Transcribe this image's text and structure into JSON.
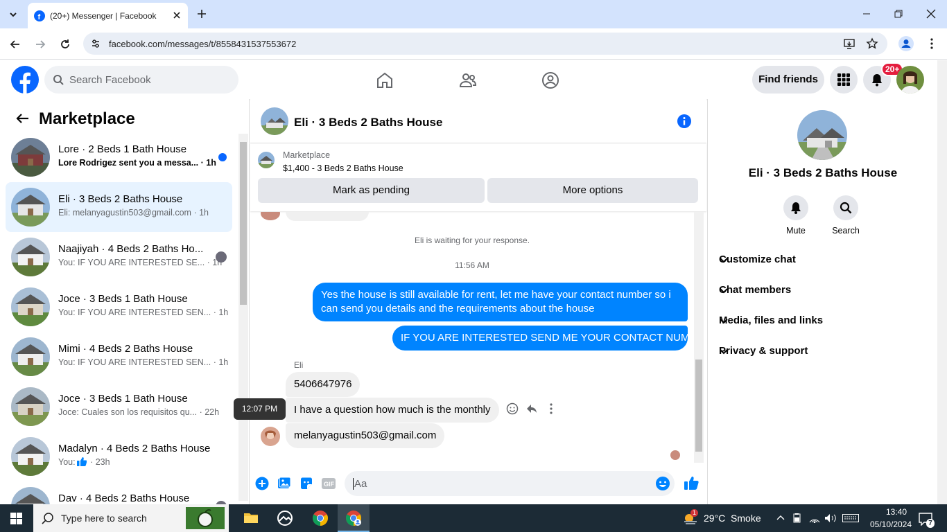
{
  "browser": {
    "tab_title": "(20+) Messenger | Facebook",
    "url": "facebook.com/messages/t/8558431537553672"
  },
  "fb": {
    "search_placeholder": "Search Facebook",
    "find_friends": "Find friends",
    "notif_badge": "20+"
  },
  "left": {
    "title": "Marketplace",
    "conversations": [
      {
        "name": "Lore · 2 Beds 1 Bath House",
        "preview": "Lore Rodrigez sent you a messa...",
        "time": "· 1h",
        "unread": true
      },
      {
        "name": "Eli · 3 Beds 2 Baths House",
        "preview": "Eli: melanyagustin503@gmail.com",
        "time": "· 1h",
        "selected": true
      },
      {
        "name": "Naajiyah · 4 Beds 2 Baths Ho...",
        "preview": "You: IF YOU ARE INTERESTED SE...",
        "time": "· 1h"
      },
      {
        "name": "Joce · 3 Beds 1 Bath House",
        "preview": "You: IF YOU ARE INTERESTED SEN...",
        "time": "· 1h"
      },
      {
        "name": "Mimi · 4 Beds 2 Baths House",
        "preview": "You: IF YOU ARE INTERESTED SEN...",
        "time": "· 1h"
      },
      {
        "name": "Joce · 3 Beds 1 Bath House",
        "preview": "Joce: Cuales son los requisitos qu...",
        "time": "· 22h"
      },
      {
        "name": "Madalyn · 4 Beds 2 Baths House",
        "preview": "You:",
        "time": "· 23h"
      },
      {
        "name": "Dav · 4 Beds 2 Baths House",
        "preview": "",
        "time": ""
      }
    ]
  },
  "chat": {
    "title": "Eli · 3 Beds 2 Baths House",
    "listing_label": "Marketplace",
    "listing_price": "$1,400 - 3 Beds 2 Baths House",
    "mark_pending": "Mark as pending",
    "more_options": "More options",
    "waiting_notice": "Eli is waiting for your response.",
    "time_divider": "11:56 AM",
    "messages": [
      {
        "from": "me",
        "text": "Yes the house is still available for rent, let me have your contact number so i can send you details and the requirements about the house"
      },
      {
        "from": "me",
        "text": "IF YOU ARE INTERESTED SEND ME YOUR CONTACT NUMBER"
      },
      {
        "from": "them",
        "sender": "Eli",
        "text": "5406647976"
      },
      {
        "from": "them",
        "text": "I have a question how much is the monthly"
      },
      {
        "from": "them",
        "text": "melanyagustin503@gmail.com"
      }
    ],
    "tooltip_time": "12:07 PM",
    "composer_placeholder": "Aa"
  },
  "right": {
    "name": "Eli · 3 Beds 2 Baths House",
    "mute": "Mute",
    "search": "Search",
    "sections": [
      "Customize chat",
      "Chat members",
      "Media, files and links",
      "Privacy & support"
    ]
  },
  "taskbar": {
    "search_placeholder": "Type here to search",
    "weather": "29°C  Smoke",
    "time": "13:40",
    "date": "05/10/2024",
    "notif_count": "7",
    "weather_badge": "1"
  },
  "colors": {
    "fb_blue": "#0866ff",
    "messenger_blue": "#0084ff"
  }
}
